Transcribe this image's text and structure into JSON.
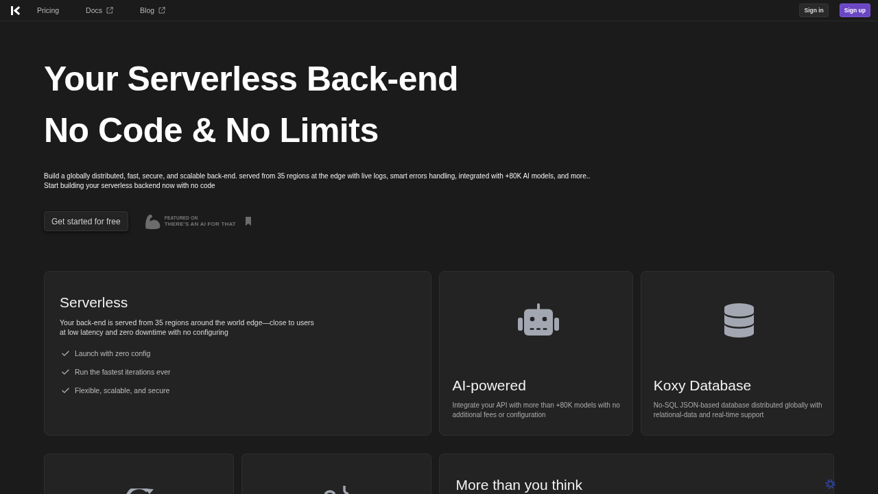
{
  "nav": {
    "links": [
      {
        "label": "Pricing",
        "external": false
      },
      {
        "label": "Docs",
        "external": true
      },
      {
        "label": "Blog",
        "external": true
      }
    ],
    "buttons": [
      {
        "label": "Sign in",
        "kind": "secondary"
      },
      {
        "label": "Sign up",
        "kind": "primary"
      }
    ]
  },
  "hero": {
    "title_lines": [
      "Your Serverless Back-end",
      "No Code & No Limits"
    ],
    "subtitle_lines": [
      "Build a globally distributed, fast, secure, and scalable back-end. served from 35 regions at the edge with live logs, smart errors handling, integrated with +80K AI models, and more..",
      "Start building your serverless backend now with no code"
    ],
    "cta": "Get started for free",
    "featured_badge": {
      "kicker": "FEATURED ON",
      "name": "THERE'S AN AI FOR THAT"
    }
  },
  "features": [
    {
      "kind": "checklist",
      "title": "Serverless",
      "description": "Your back-end is served from 35 regions around the world edge—close to users at low latency and zero downtime with no configuring",
      "checklist": [
        "Launch with zero config",
        "Run the fastest iterations ever",
        "Flexible, scalable, and secure"
      ]
    },
    {
      "kind": "icon",
      "title": "AI-powered",
      "description": "Integrate your API with more than +80K models with no additional fees or configuration"
    },
    {
      "kind": "icon",
      "title": "Koxy Database",
      "description": "No-SQL JSON-based database distributed globally with relational-data and real-time support"
    },
    {
      "kind": "icon"
    },
    {
      "kind": "icon"
    },
    {
      "kind": "text",
      "title": "More than you think"
    }
  ]
}
